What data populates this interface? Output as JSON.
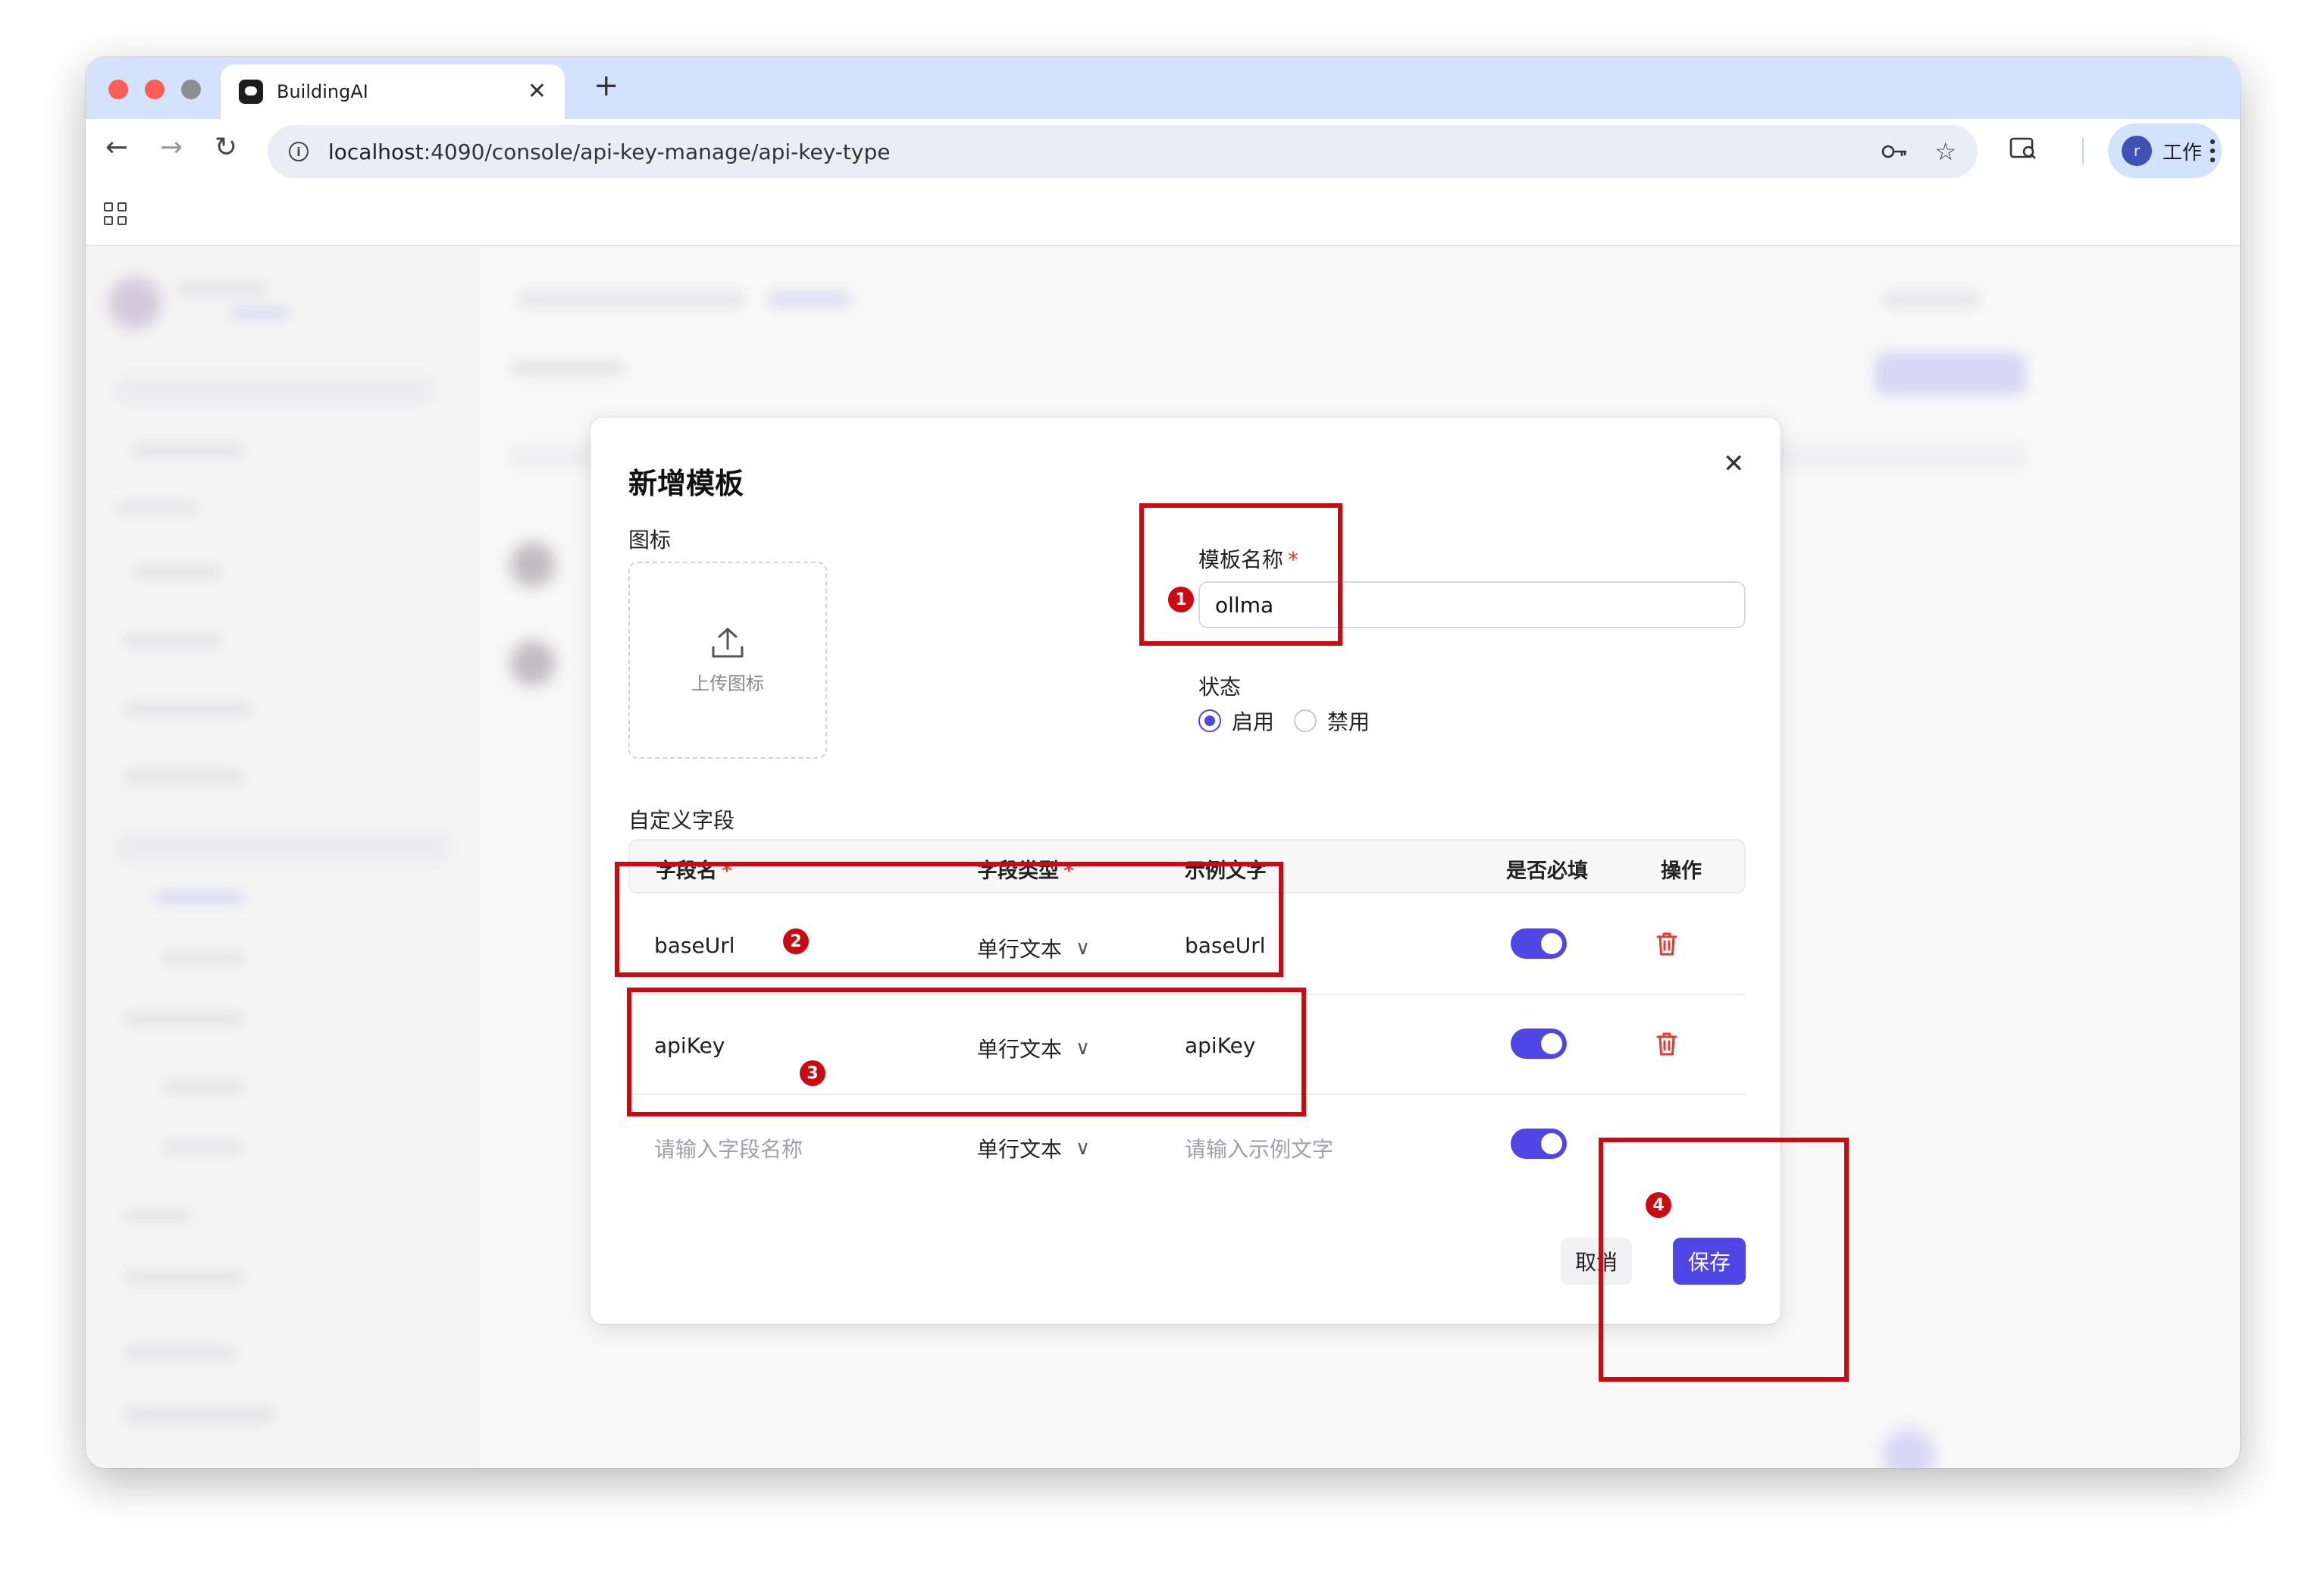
{
  "browser": {
    "tab_title": "BuildingAI",
    "url_host": "localhost",
    "url_rest": ":4090/console/api-key-manage/api-key-type",
    "profile_initial": "r",
    "profile_name": "工作",
    "traffic_lights": [
      "#ff5f57",
      "#ff5f57",
      "#8e8e8e"
    ]
  },
  "modal": {
    "title": "新增模板",
    "icon_label": "图标",
    "upload_text": "上传图标",
    "template_name_label": "模板名称",
    "template_name_value": "ollma",
    "status_label": "状态",
    "status_options": [
      "启用",
      "禁用"
    ],
    "status_selected": "启用",
    "custom_fields_label": "自定义字段",
    "table_headers": {
      "field_name": "字段名",
      "field_type": "字段类型",
      "example_text": "示例文字",
      "required": "是否必填",
      "actions": "操作"
    },
    "rows": [
      {
        "name": "baseUrl",
        "type": "单行文本",
        "example": "baseUrl",
        "required": true
      },
      {
        "name": "apiKey",
        "type": "单行文本",
        "example": "apiKey",
        "required": true
      }
    ],
    "new_row": {
      "name_placeholder": "请输入字段名称",
      "type": "单行文本",
      "example_placeholder": "请输入示例文字",
      "required": true
    },
    "cancel_label": "取消",
    "save_label": "保存"
  },
  "annotations": [
    "1",
    "2",
    "3",
    "4"
  ],
  "colors": {
    "accent": "#4f46e5",
    "annotation_red": "#cc0a13",
    "delete_red": "#e53935",
    "tabstrip": "#d3e3fd"
  }
}
